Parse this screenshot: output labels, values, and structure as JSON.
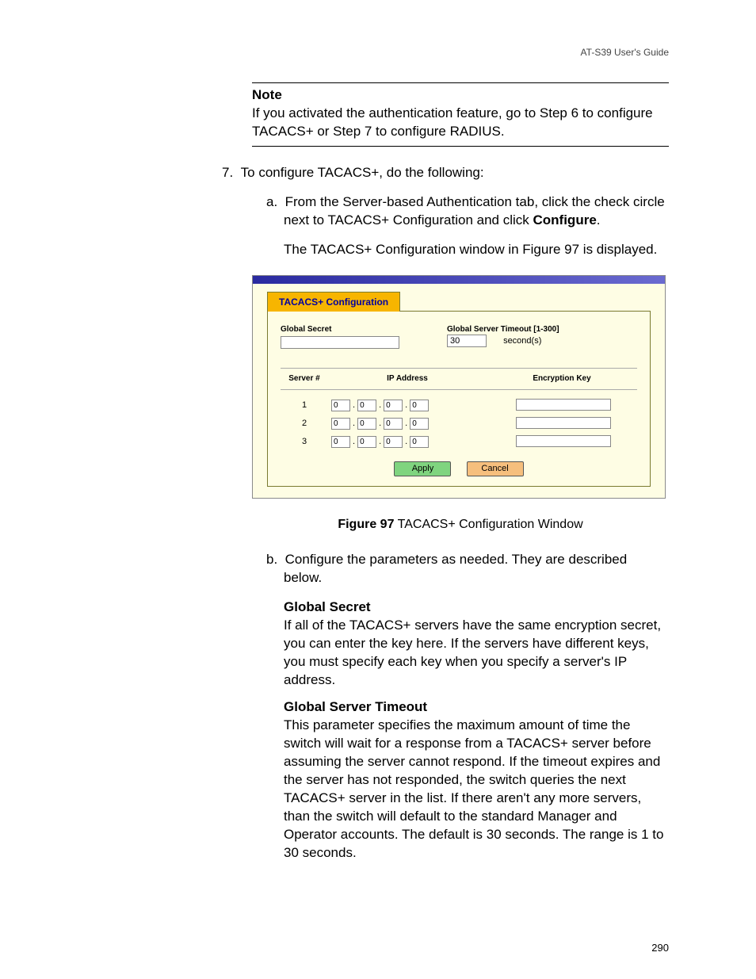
{
  "header": "AT-S39 User's Guide",
  "note": {
    "title": "Note",
    "body": "If you activated the authentication feature, go to Step 6 to configure TACACS+ or Step 7 to configure RADIUS."
  },
  "step7": {
    "num": "7.",
    "text": "To configure TACACS+, do the following:"
  },
  "sub_a": {
    "letter": "a.",
    "text_part1": "From the Server-based Authentication tab, click the check circle next to TACACS+ Configuration and click ",
    "bold": "Configure",
    "text_part2": ".",
    "cont": "The TACACS+ Configuration window in Figure 97 is displayed."
  },
  "window": {
    "tab": "TACACS+ Configuration",
    "global_secret_label": "Global Secret",
    "global_secret_value": "",
    "timeout_label": "Global Server Timeout [1-300]",
    "timeout_value": "30",
    "timeout_unit": "second(s)",
    "cols": {
      "server": "Server #",
      "ip": "IP Address",
      "ek": "Encryption Key"
    },
    "rows": [
      {
        "n": "1",
        "ip": [
          "0",
          "0",
          "0",
          "0"
        ],
        "ek": ""
      },
      {
        "n": "2",
        "ip": [
          "0",
          "0",
          "0",
          "0"
        ],
        "ek": ""
      },
      {
        "n": "3",
        "ip": [
          "0",
          "0",
          "0",
          "0"
        ],
        "ek": ""
      }
    ],
    "apply": "Apply",
    "cancel": "Cancel"
  },
  "figure_caption": {
    "bold": "Figure 97",
    "rest": "  TACACS+ Configuration Window"
  },
  "sub_b": {
    "letter": "b.",
    "text": "Configure the parameters as needed. They are described below."
  },
  "params": {
    "gs": {
      "title": "Global Secret",
      "body": "If all of the TACACS+ servers have the same encryption secret, you can enter the key here. If the servers have different keys, you must specify each key when you specify a server's IP address."
    },
    "gst": {
      "title": "Global Server Timeout",
      "body": "This parameter specifies the maximum amount of time the switch will wait for a response from a TACACS+ server before assuming the server cannot respond. If the timeout expires and the server has not responded, the switch queries the next TACACS+ server in the list. If there aren't any more servers, than the switch will default to the standard Manager and Operator accounts. The default is 30 seconds. The range is 1 to 30 seconds."
    }
  },
  "page_number": "290"
}
